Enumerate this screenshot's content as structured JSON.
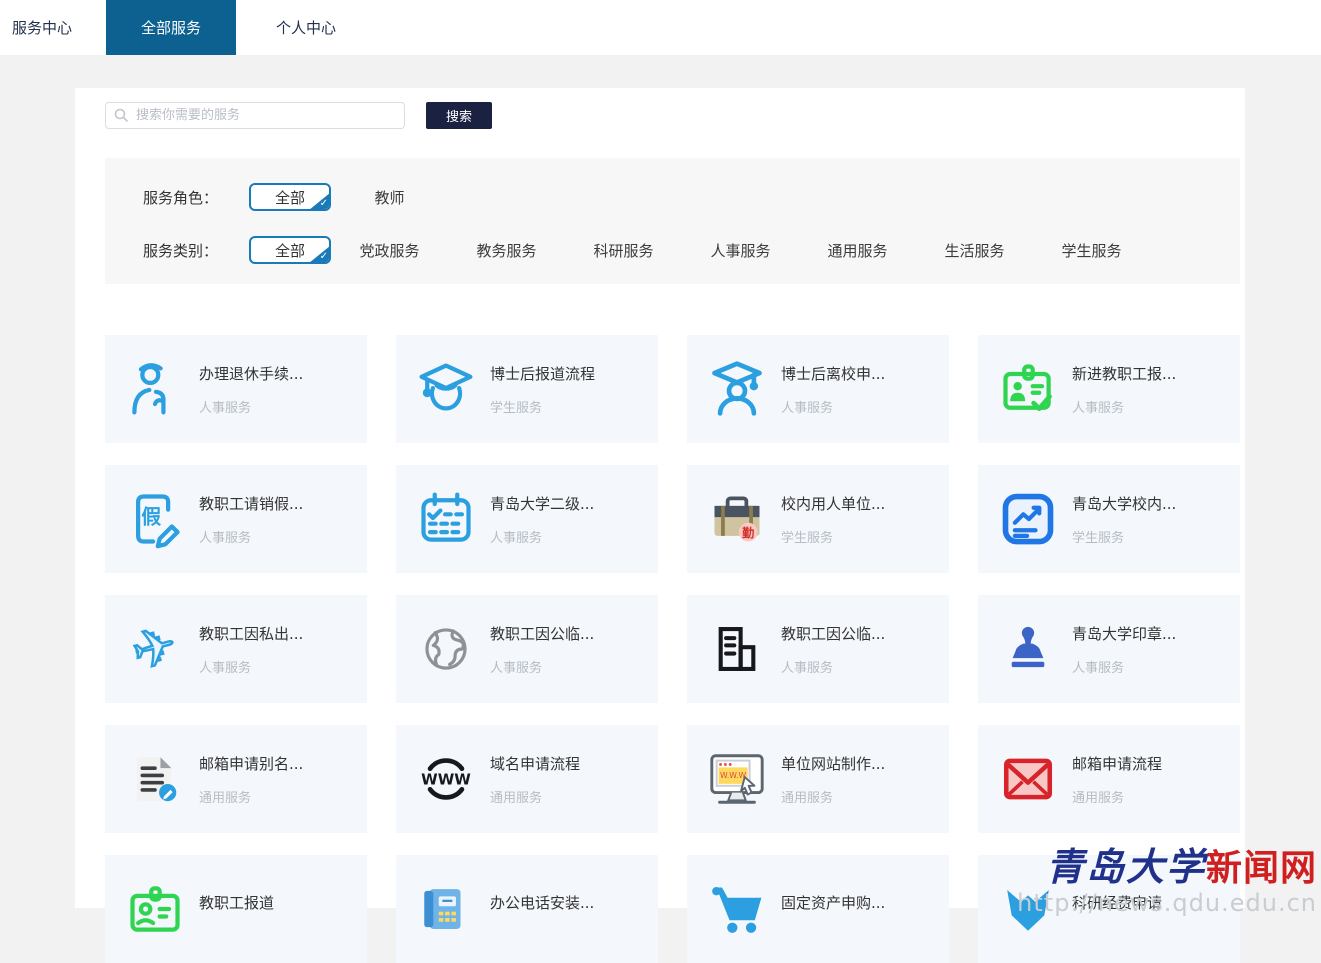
{
  "nav": {
    "tabs": [
      {
        "label": "服务中心",
        "active": false
      },
      {
        "label": "全部服务",
        "active": true
      },
      {
        "label": "个人中心",
        "active": false
      }
    ]
  },
  "search": {
    "placeholder": "搜索你需要的服务",
    "button_label": "搜索"
  },
  "filters": {
    "role": {
      "label": "服务角色：",
      "selected": "全部",
      "options": [
        "教师"
      ]
    },
    "category": {
      "label": "服务类别：",
      "selected": "全部",
      "options": [
        "党政服务",
        "教务服务",
        "科研服务",
        "人事服务",
        "通用服务",
        "生活服务",
        "学生服务"
      ]
    }
  },
  "cards": [
    {
      "title": "办理退休手续...",
      "category": "人事服务",
      "icon": "retiree-icon"
    },
    {
      "title": "博士后报道流程",
      "category": "学生服务",
      "icon": "graduation-cap-icon"
    },
    {
      "title": "博士后离校申...",
      "category": "人事服务",
      "icon": "graduate-person-icon"
    },
    {
      "title": "新进教职工报...",
      "category": "人事服务",
      "icon": "id-card-check-icon"
    },
    {
      "title": "教职工请销假...",
      "category": "人事服务",
      "icon": "leave-note-icon"
    },
    {
      "title": "青岛大学二级...",
      "category": "人事服务",
      "icon": "calendar-check-icon"
    },
    {
      "title": "校内用人单位...",
      "category": "学生服务",
      "icon": "briefcase-badge-icon"
    },
    {
      "title": "青岛大学校内...",
      "category": "学生服务",
      "icon": "trend-chart-icon"
    },
    {
      "title": "教职工因私出...",
      "category": "人事服务",
      "icon": "airplane-icon"
    },
    {
      "title": "教职工因公临...",
      "category": "人事服务",
      "icon": "globe-icon"
    },
    {
      "title": "教职工因公临...",
      "category": "人事服务",
      "icon": "building-icon"
    },
    {
      "title": "青岛大学印章...",
      "category": "人事服务",
      "icon": "stamp-icon"
    },
    {
      "title": "邮箱申请别名...",
      "category": "通用服务",
      "icon": "document-edit-icon"
    },
    {
      "title": "域名申请流程",
      "category": "通用服务",
      "icon": "www-icon"
    },
    {
      "title": "单位网站制作...",
      "category": "通用服务",
      "icon": "website-monitor-icon"
    },
    {
      "title": "邮箱申请流程",
      "category": "通用服务",
      "icon": "envelope-icon"
    },
    {
      "title": "教职工报道",
      "category": "",
      "icon": "id-badge-icon"
    },
    {
      "title": "办公电话安装...",
      "category": "",
      "icon": "telephone-icon"
    },
    {
      "title": "固定资产申购...",
      "category": "",
      "icon": "cart-icon"
    },
    {
      "title": "科研经费申请",
      "category": "",
      "icon": "research-fund-icon"
    }
  ],
  "watermark": {
    "text_blue": "青岛大学",
    "text_red": "新闻网",
    "url": "http://news.qdu.edu.cn"
  },
  "colors": {
    "accent_blue": "#2b9fdf",
    "accent_border": "#1a7ab8",
    "nav_active": "#0d6191",
    "search_button": "#1b2140",
    "green": "#2fd551",
    "red": "#d8232a",
    "watermark_blue": "#20318c",
    "watermark_red": "#cf1f1f",
    "page_bg": "#f2f2f2"
  }
}
